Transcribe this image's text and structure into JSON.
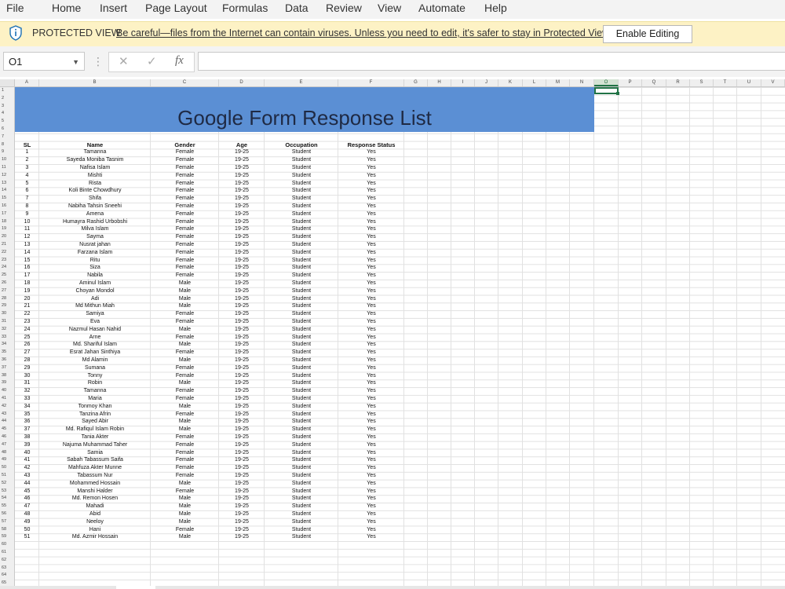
{
  "menu": [
    "File",
    "Home",
    "Insert",
    "Page Layout",
    "Formulas",
    "Data",
    "Review",
    "View",
    "Automate",
    "Help"
  ],
  "protected_view": {
    "title": "PROTECTED VIEW",
    "message": "Be careful—files from the Internet can contain viruses. Unless you need to edit, it's safer to stay in Protected View.",
    "button": "Enable Editing"
  },
  "formula_bar": {
    "name_box": "O1",
    "cancel_icon": "✕",
    "enter_icon": "✓",
    "fx_label": "fx",
    "formula": ""
  },
  "columns": [
    "A",
    "B",
    "C",
    "D",
    "E",
    "F",
    "G",
    "H",
    "I",
    "J",
    "K",
    "L",
    "M",
    "N",
    "O",
    "P",
    "Q",
    "R",
    "S",
    "T",
    "U",
    "V"
  ],
  "active_column": "O",
  "banner_title": "Google Form Response List",
  "table": {
    "headers": [
      "SL",
      "Name",
      "Gender",
      "Age",
      "Occupation",
      "Response Status"
    ],
    "rows": [
      [
        "1",
        "Tamanna",
        "Female",
        "19-25",
        "Student",
        "Yes"
      ],
      [
        "2",
        "Sayeda Moniba Tasnim",
        "Female",
        "19-25",
        "Student",
        "Yes"
      ],
      [
        "3",
        "Nafisa Islam",
        "Female",
        "19-25",
        "Student",
        "Yes"
      ],
      [
        "4",
        "Mishti",
        "Female",
        "19-25",
        "Student",
        "Yes"
      ],
      [
        "5",
        "Rista",
        "Female",
        "19-25",
        "Student",
        "Yes"
      ],
      [
        "6",
        "Koli Binte Chowdhury",
        "Female",
        "19-25",
        "Student",
        "Yes"
      ],
      [
        "7",
        "Shifa",
        "Female",
        "19-25",
        "Student",
        "Yes"
      ],
      [
        "8",
        "Nabiha Tahsin Sneehi",
        "Female",
        "19-25",
        "Student",
        "Yes"
      ],
      [
        "9",
        "Amena",
        "Female",
        "19-25",
        "Student",
        "Yes"
      ],
      [
        "10",
        "Humayra Rashid Urbobshi",
        "Female",
        "19-25",
        "Student",
        "Yes"
      ],
      [
        "11",
        "Milva Islam",
        "Female",
        "19-25",
        "Student",
        "Yes"
      ],
      [
        "12",
        "Sayma",
        "Female",
        "19-25",
        "Student",
        "Yes"
      ],
      [
        "13",
        "Nusrat jahan",
        "Female",
        "19-25",
        "Student",
        "Yes"
      ],
      [
        "14",
        "Farzana Islam",
        "Female",
        "19-25",
        "Student",
        "Yes"
      ],
      [
        "15",
        "Ritu",
        "Female",
        "19-25",
        "Student",
        "Yes"
      ],
      [
        "16",
        "Siza",
        "Female",
        "19-25",
        "Student",
        "Yes"
      ],
      [
        "17",
        "Nabila",
        "Female",
        "19-25",
        "Student",
        "Yes"
      ],
      [
        "18",
        "Aminul Islam",
        "Male",
        "19-25",
        "Student",
        "Yes"
      ],
      [
        "19",
        "Choyan Mondol",
        "Male",
        "19-25",
        "Student",
        "Yes"
      ],
      [
        "20",
        "Adi",
        "Male",
        "19-25",
        "Student",
        "Yes"
      ],
      [
        "21",
        "Md Mithun Miah",
        "Male",
        "19-25",
        "Student",
        "Yes"
      ],
      [
        "22",
        "Samiya",
        "Female",
        "19-25",
        "Student",
        "Yes"
      ],
      [
        "23",
        "Eva",
        "Female",
        "19-25",
        "Student",
        "Yes"
      ],
      [
        "24",
        "Nazmul Hasan Nahid",
        "Male",
        "19-25",
        "Student",
        "Yes"
      ],
      [
        "25",
        "Arne",
        "Female",
        "19-25",
        "Student",
        "Yes"
      ],
      [
        "26",
        "Md. Shariful Islam",
        "Male",
        "19-25",
        "Student",
        "Yes"
      ],
      [
        "27",
        "Esrat Jahan Sinthiya",
        "Female",
        "19-25",
        "Student",
        "Yes"
      ],
      [
        "28",
        "Md Alamin",
        "Male",
        "19-25",
        "Student",
        "Yes"
      ],
      [
        "29",
        "Sumana",
        "Female",
        "19-25",
        "Student",
        "Yes"
      ],
      [
        "30",
        "Tonny",
        "Female",
        "19-25",
        "Student",
        "Yes"
      ],
      [
        "31",
        "Robin",
        "Male",
        "19-25",
        "Student",
        "Yes"
      ],
      [
        "32",
        "Tamanna",
        "Female",
        "19-25",
        "Student",
        "Yes"
      ],
      [
        "33",
        "Maria",
        "Female",
        "19-25",
        "Student",
        "Yes"
      ],
      [
        "34",
        "Tonmoy Khan",
        "Male",
        "19-25",
        "Student",
        "Yes"
      ],
      [
        "35",
        "Tanzina Afrin",
        "Female",
        "19-25",
        "Student",
        "Yes"
      ],
      [
        "36",
        "Sayed Abir",
        "Male",
        "19-25",
        "Student",
        "Yes"
      ],
      [
        "37",
        "Md. Rafiqul Islam Robin",
        "Male",
        "19-25",
        "Student",
        "Yes"
      ],
      [
        "38",
        "Tania Akter",
        "Female",
        "19-25",
        "Student",
        "Yes"
      ],
      [
        "39",
        "Najuma Muhammad Taher",
        "Female",
        "19-25",
        "Student",
        "Yes"
      ],
      [
        "40",
        "Samia",
        "Female",
        "19-25",
        "Student",
        "Yes"
      ],
      [
        "41",
        "Sabah Tabassum Saifa",
        "Female",
        "19-25",
        "Student",
        "Yes"
      ],
      [
        "42",
        "Mahfuza Akter Munne",
        "Female",
        "19-25",
        "Student",
        "Yes"
      ],
      [
        "43",
        "Tabassum Nur",
        "Female",
        "19-25",
        "Student",
        "Yes"
      ],
      [
        "44",
        "Mohammed Hossain",
        "Male",
        "19-25",
        "Student",
        "Yes"
      ],
      [
        "45",
        "Manshi Halder",
        "Female",
        "19-25",
        "Student",
        "Yes"
      ],
      [
        "46",
        "Md. Remon Hosen",
        "Male",
        "19-25",
        "Student",
        "Yes"
      ],
      [
        "47",
        "Mahadi",
        "Male",
        "19-25",
        "Student",
        "Yes"
      ],
      [
        "48",
        "Abid",
        "Male",
        "19-25",
        "Student",
        "Yes"
      ],
      [
        "49",
        "Neeloy",
        "Male",
        "19-25",
        "Student",
        "Yes"
      ],
      [
        "50",
        "Hani",
        "Female",
        "19-25",
        "Student",
        "Yes"
      ],
      [
        "51",
        "Md. Azmir Hossain",
        "Male",
        "19-25",
        "Student",
        "Yes"
      ]
    ]
  },
  "row_numbers_start": 1,
  "row_numbers_end": 65,
  "colors": {
    "banner": "#5b8fd4",
    "accent_green": "#217346",
    "warning_bar": "#fdf2c5"
  }
}
